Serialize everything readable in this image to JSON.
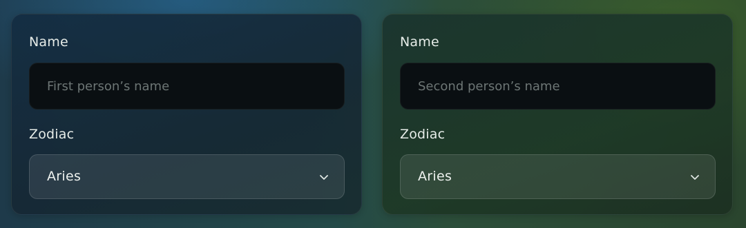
{
  "person1": {
    "name_label": "Name",
    "name_placeholder": "First person’s name",
    "name_value": "",
    "zodiac_label": "Zodiac",
    "zodiac_selected": "Aries"
  },
  "person2": {
    "name_label": "Name",
    "name_placeholder": "Second person’s name",
    "name_value": "",
    "zodiac_label": "Zodiac",
    "zodiac_selected": "Aries"
  },
  "icons": {
    "dropdown": "chevron-down-icon"
  }
}
